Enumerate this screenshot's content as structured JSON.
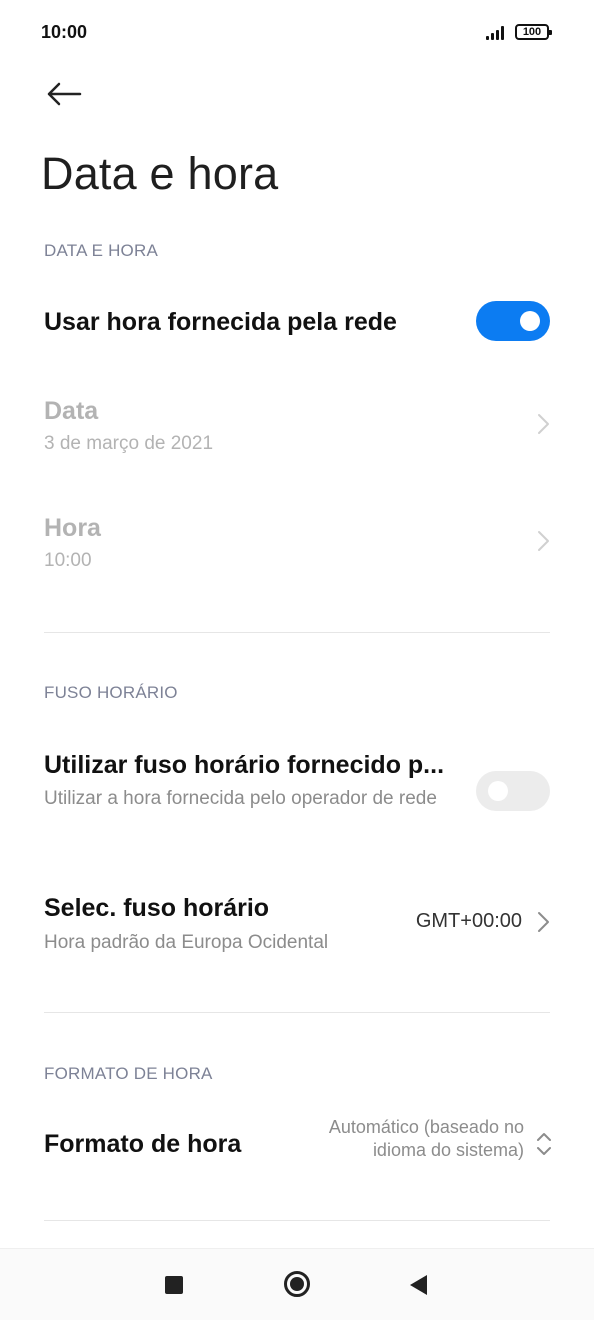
{
  "status_bar": {
    "time": "10:00",
    "battery": "100"
  },
  "header": {
    "title": "Data e hora"
  },
  "sections": {
    "date_time": {
      "header": "DATA E HORA",
      "network_time": {
        "label": "Usar hora fornecida pela rede",
        "enabled": true
      },
      "date": {
        "label": "Data",
        "value": "3 de março de 2021"
      },
      "time": {
        "label": "Hora",
        "value": "10:00"
      }
    },
    "time_zone": {
      "header": "FUSO HORÁRIO",
      "network_zone": {
        "label": "Utilizar fuso horário fornecido p...",
        "description": "Utilizar a hora fornecida pelo operador de rede",
        "enabled": false
      },
      "select_zone": {
        "label": "Selec. fuso horário",
        "description": "Hora padrão da Europa Ocidental",
        "value": "GMT+00:00"
      }
    },
    "time_format": {
      "header": "FORMATO DE HORA",
      "format": {
        "label": "Formato de hora",
        "value": "Automático (baseado no idioma do sistema)"
      }
    }
  },
  "colors": {
    "accent": "#0c7cf2",
    "section_header": "#7d8296",
    "disabled": "#b3b3b3"
  }
}
